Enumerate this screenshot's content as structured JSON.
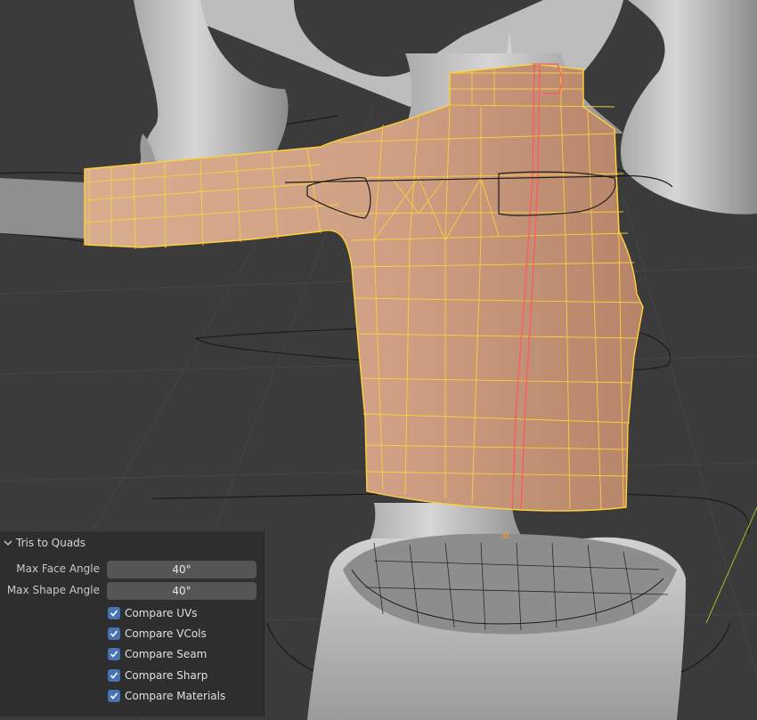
{
  "operator_panel": {
    "title": "Tris to Quads",
    "fields": [
      {
        "label": "Max Face Angle",
        "value": "40°"
      },
      {
        "label": "Max Shape Angle",
        "value": "40°"
      }
    ],
    "checkboxes": [
      {
        "label": "Compare UVs",
        "checked": true
      },
      {
        "label": "Compare VCols",
        "checked": true
      },
      {
        "label": "Compare Seam",
        "checked": true
      },
      {
        "label": "Compare Sharp",
        "checked": true
      },
      {
        "label": "Compare Materials",
        "checked": true
      }
    ]
  },
  "colors": {
    "viewport_bg": "#3a3a3a",
    "mesh_fill": "#d7a98a",
    "wire_selected": "#ffd23a",
    "seam": "#ff5a5a",
    "mannequin": "#c9c9c9",
    "checkbox": "#4772b3"
  }
}
